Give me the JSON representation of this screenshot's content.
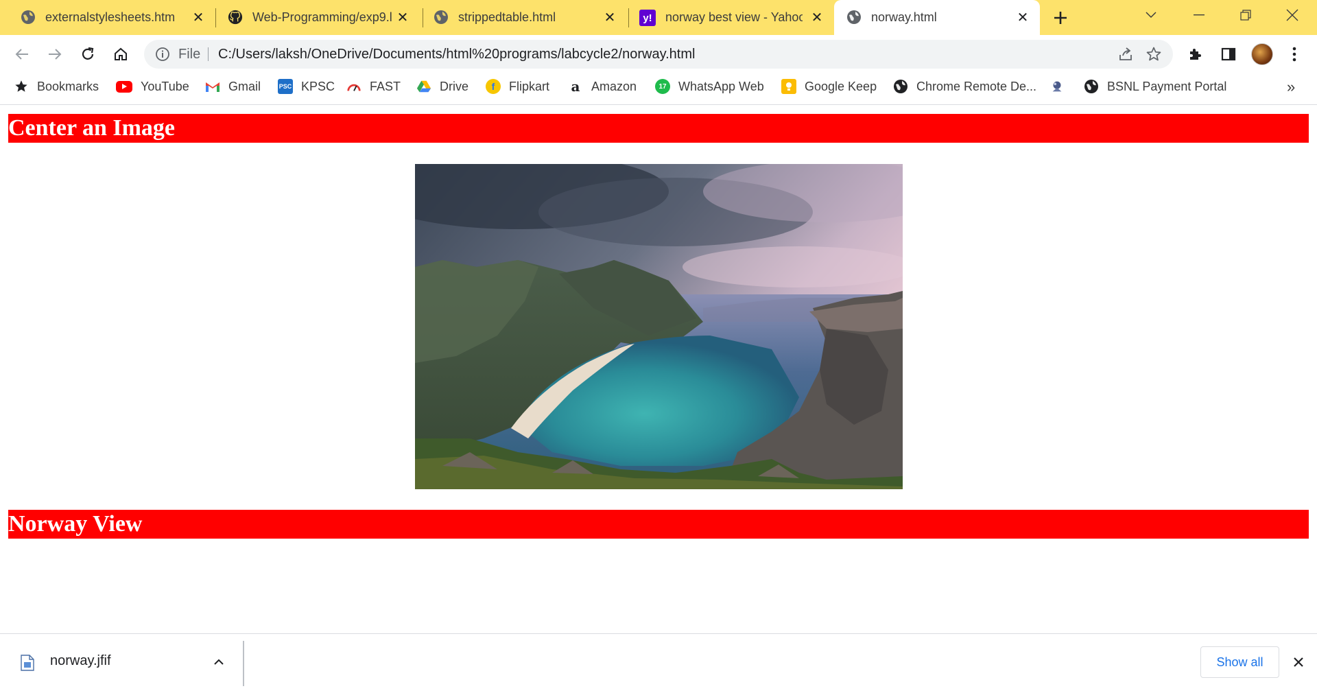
{
  "tabs": [
    {
      "title": "externalstylesheets.html",
      "icon": "globe-icon"
    },
    {
      "title": "Web-Programming/exp9.l",
      "icon": "github-icon"
    },
    {
      "title": "strippedtable.html",
      "icon": "globe-icon"
    },
    {
      "title": "norway best view - Yahoo",
      "icon": "yahoo-icon"
    },
    {
      "title": "norway.html",
      "icon": "globe-icon",
      "active": true
    }
  ],
  "omnibox": {
    "scheme": "File",
    "url": "C:/Users/laksh/OneDrive/Documents/html%20programs/labcycle2/norway.html"
  },
  "bookmarks": [
    {
      "label": "Bookmarks",
      "icon": "star-icon"
    },
    {
      "label": "YouTube",
      "icon": "youtube-icon"
    },
    {
      "label": "Gmail",
      "icon": "gmail-icon"
    },
    {
      "label": "KPSC",
      "icon": "kpsc-icon"
    },
    {
      "label": "FAST",
      "icon": "fast-icon"
    },
    {
      "label": "Drive",
      "icon": "drive-icon"
    },
    {
      "label": "Flipkart",
      "icon": "flipkart-icon"
    },
    {
      "label": "Amazon",
      "icon": "amazon-icon"
    },
    {
      "label": "WhatsApp Web",
      "icon": "whatsapp-icon"
    },
    {
      "label": "Google Keep",
      "icon": "keep-icon"
    },
    {
      "label": "Chrome Remote De...",
      "icon": "globe-icon"
    },
    {
      "label": "",
      "icon": "app-icon"
    },
    {
      "label": "BSNL Payment Portal",
      "icon": "globe-icon"
    }
  ],
  "page": {
    "heading1": "Center an Image",
    "heading2": "Norway View",
    "heading_bg": "#ff0000",
    "heading_color": "#ffffff"
  },
  "downloads": {
    "filename": "norway.jfif",
    "show_all": "Show all"
  },
  "colors": {
    "tabstrip": "#fde26b",
    "link": "#1a73e8"
  }
}
